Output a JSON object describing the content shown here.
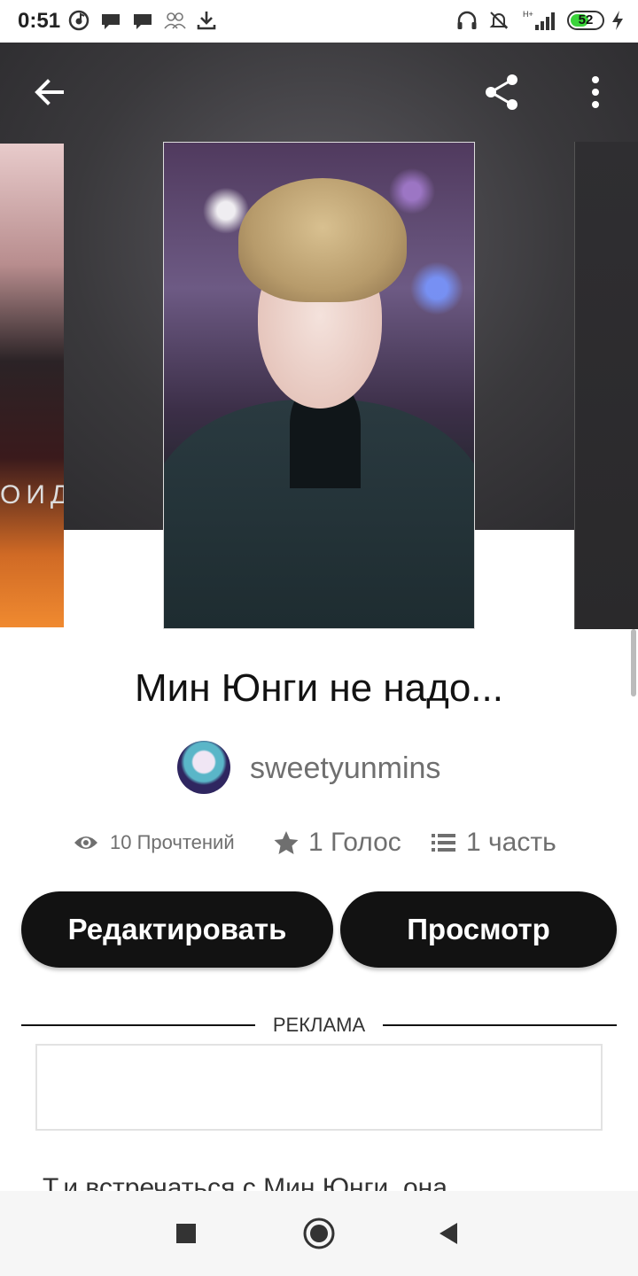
{
  "status_bar": {
    "time": "0:51",
    "battery_level": "52",
    "left_icons": [
      "music-app-icon",
      "chat-bubble-icon",
      "chat-bubble-icon",
      "contacts-icon",
      "download-icon"
    ],
    "right_icons": [
      "headphones-icon",
      "notifications-muted-icon",
      "signal-icon",
      "battery-icon",
      "charging-icon"
    ]
  },
  "toolbar": {
    "back_icon": "arrow-left-icon",
    "share_icon": "share-icon",
    "more_icon": "more-vertical-icon"
  },
  "cover_left": {
    "overlay_text": "ОИД"
  },
  "story": {
    "title": "Мин Юнги не надо...",
    "author": "sweetyunmins",
    "reads": "10 Прочтений",
    "votes": "1 Голос",
    "parts": "1 часть"
  },
  "actions": {
    "edit_label": "Редактировать",
    "preview_label": "Просмотр"
  },
  "ad": {
    "label": "РЕКЛАМА"
  },
  "description": "Т.и встречаться с Мин Юнги, она",
  "colors": {
    "button_bg": "#121212",
    "button_text": "#ffffff",
    "stat_text": "#6f6f6f",
    "battery_fill": "#3ad33a"
  },
  "navbar": {
    "recents_icon": "square-icon",
    "home_icon": "circle-icon",
    "back_icon": "triangle-back-icon"
  }
}
